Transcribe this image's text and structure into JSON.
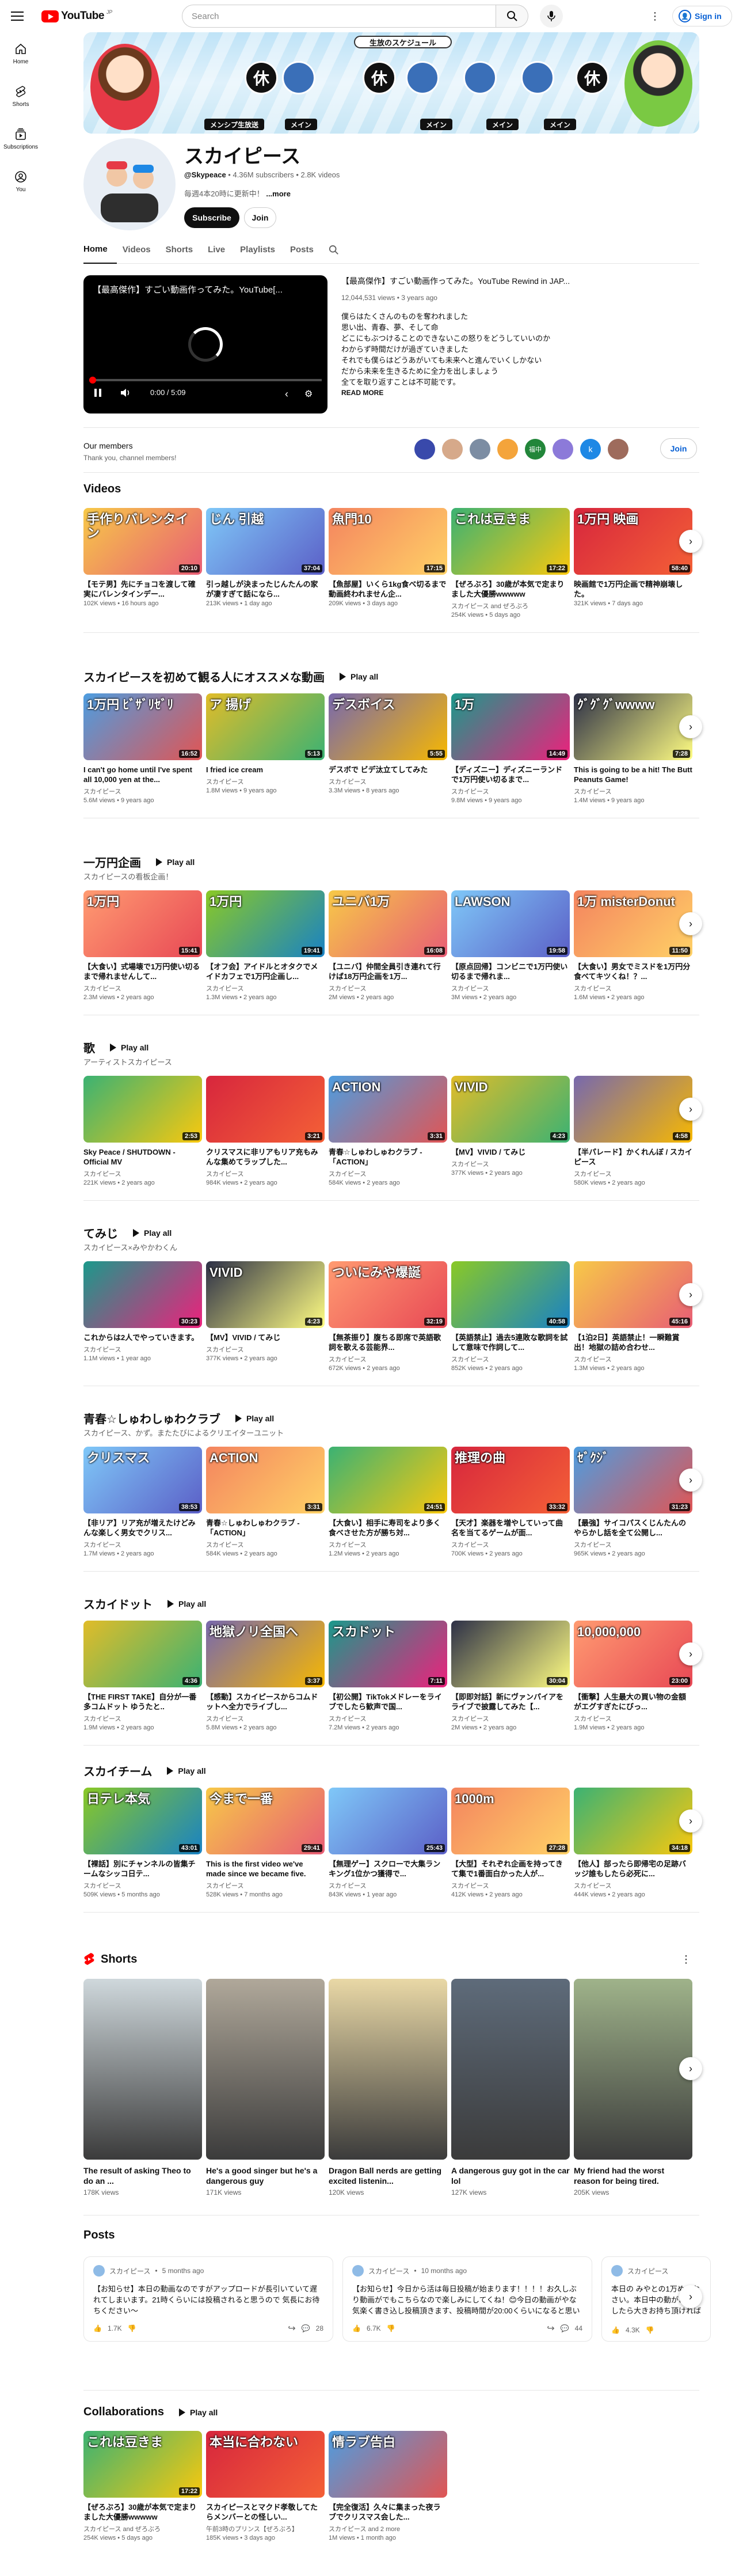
{
  "header": {
    "logo_text": "YouTube",
    "logo_cc": "JP",
    "search_placeholder": "Search",
    "signin_label": "Sign in"
  },
  "rail": [
    {
      "label": "Home",
      "icon": "home-icon"
    },
    {
      "label": "Shorts",
      "icon": "shorts-icon"
    },
    {
      "label": "Subscriptions",
      "icon": "subscriptions-icon"
    },
    {
      "label": "You",
      "icon": "you-icon"
    }
  ],
  "banner": {
    "title": "生放のスケジュール",
    "tile_text": "休",
    "tags": [
      "メンシプ生放送",
      "メイン",
      "メイン",
      "メイン",
      "メイン"
    ]
  },
  "channel": {
    "name": "スカイピース",
    "handle": "@Skypeace",
    "subscribers": "4.36M subscribers",
    "videos": "2.8K videos",
    "description": "毎週4本20時に更新中！",
    "more": "...more",
    "subscribe_label": "Subscribe",
    "join_label": "Join",
    "tabs": [
      "Home",
      "Videos",
      "Shorts",
      "Live",
      "Playlists",
      "Posts"
    ]
  },
  "featured": {
    "player_title": "【最高傑作】すごい動画作ってみた。YouTube[...",
    "time": "0:00 / 5:09",
    "title": "【最高傑作】すごい動画作ってみた。YouTube Rewind in JAP...",
    "meta": "12,044,531 views • 3 years ago",
    "description": "僕らはたくさんのものを奪われました\n思い出、青春、夢、そして命\nどこにもぶつけることのできないこの怒りをどうしていいのか\nわからず時間だけが過ぎていきました\nそれでも僕らはどうあがいても未来へと進んでいくしかない\nだから未来を生きるために全力を出しましょう\n全てを取り返すことは不可能です。",
    "read_more": "READ MORE"
  },
  "members": {
    "title": "Our members",
    "subtitle": "Thank you, channel members!",
    "avatars": [
      "",
      "",
      "",
      "",
      "福中",
      "",
      "k",
      ""
    ],
    "join_label": "Join"
  },
  "shelves": [
    {
      "title": "Videos",
      "subtitle": "",
      "play_all": "",
      "cards": [
        {
          "cap": "手作りバレンタイン",
          "dur": "20:10",
          "title": "【モテ男】先にチョコを渡して確実にバレンタインデー...",
          "channel": "",
          "meta": "102K views • 16 hours ago"
        },
        {
          "cap": "じん 引越",
          "dur": "37:04",
          "title": "引っ越しが決まったじんたんの家が凄すぎて話になら...",
          "channel": "",
          "meta": "213K views • 1 day ago"
        },
        {
          "cap": "魚門10",
          "dur": "17:15",
          "title": "【魚部屋】いくら1kg食べ切るまで動画終われません企...",
          "channel": "",
          "meta": "209K views • 3 days ago"
        },
        {
          "cap": "これは豆きま",
          "dur": "17:22",
          "title": "【ぜろぶろ】30歳が本気で定まりました大優勝wwwww",
          "channel": "スカイピース and ぜろぶろ",
          "meta": "254K views • 5 days ago"
        },
        {
          "cap": "1万円 映画",
          "dur": "58:40",
          "title": "映画館で1万円企画で精神崩壊した。",
          "channel": "",
          "meta": "321K views • 7 days ago"
        }
      ]
    },
    {
      "title": "スカイピースを初めて観る人にオススメな動画",
      "subtitle": "",
      "play_all": "Play all",
      "cards": [
        {
          "cap": "1万円 ﾋﾞｻﾞﾘｾﾞﾘ",
          "dur": "16:52",
          "title": "I can't go home until I've spent all 10,000 yen at the...",
          "channel": "スカイピース",
          "meta": "5.6M views • 9 years ago"
        },
        {
          "cap": "ア 揚げ",
          "dur": "5:13",
          "title": "I fried ice cream",
          "channel": "スカイピース",
          "meta": "1.8M views • 9 years ago"
        },
        {
          "cap": "デスボイス",
          "dur": "5:55",
          "title": "デスボで ビデ汰立てしてみた",
          "channel": "スカイピース",
          "meta": "3.3M views • 8 years ago"
        },
        {
          "cap": "1万",
          "dur": "14:49",
          "title": "【ディズニー】ディズニーランドで1万円使い切るまで...",
          "channel": "スカイピース",
          "meta": "9.8M views • 9 years ago"
        },
        {
          "cap": "ｸﾞｸﾞｸﾞwwww",
          "dur": "7:28",
          "title": "This is going to be a hit! The Butt Peanuts Game!",
          "channel": "スカイピース",
          "meta": "1.4M views • 9 years ago"
        }
      ]
    },
    {
      "title": "一万円企画",
      "subtitle": "スカイピースの看板企画！",
      "play_all": "Play all",
      "cards": [
        {
          "cap": "1万円",
          "dur": "15:41",
          "title": "【大食い】式場壊で1万円使い切るまで帰れませんして...",
          "channel": "スカイピース",
          "meta": "2.3M views • 2 years ago"
        },
        {
          "cap": "1万円",
          "dur": "19:41",
          "title": "【オフ会】アイドルとオタクでメイドカフェで1万円企画し...",
          "channel": "スカイピース",
          "meta": "1.3M views • 2 years ago"
        },
        {
          "cap": "ユニバ1万",
          "dur": "16:08",
          "title": "【ユニバ】仲間全員引き連れて行けば18万円企画を1万...",
          "channel": "スカイピース",
          "meta": "2M views • 2 years ago"
        },
        {
          "cap": "LAWSON",
          "dur": "19:58",
          "title": "【原点回帰】コンビニで1万円使い切るまで帰れま...",
          "channel": "スカイピース",
          "meta": "3M views • 2 years ago"
        },
        {
          "cap": "1万 misterDonut",
          "dur": "11:50",
          "title": "【大食い】男女でミスドを1万円分食べてキツくね！？...",
          "channel": "スカイピース",
          "meta": "1.6M views • 2 years ago"
        }
      ]
    },
    {
      "title": "歌",
      "subtitle": "アーティストスカイピース",
      "play_all": "Play all",
      "cards": [
        {
          "cap": "",
          "dur": "2:53",
          "title": "Sky Peace / SHUTDOWN - Official MV",
          "channel": "スカイピース",
          "meta": "221K views • 2 years ago"
        },
        {
          "cap": "",
          "dur": "3:21",
          "title": "クリスマスに非リアもリア充もみんな集めてラップした...",
          "channel": "スカイピース",
          "meta": "984K views • 2 years ago"
        },
        {
          "cap": "ACTION",
          "dur": "3:31",
          "title": "青春☆しゅわしゅわクラブ - 「ACTION」",
          "channel": "スカイピース",
          "meta": "584K views • 2 years ago"
        },
        {
          "cap": "VIVID",
          "dur": "4:23",
          "title": "【MV】VIVID / てみじ",
          "channel": "スカイピース",
          "meta": "377K views • 2 years ago"
        },
        {
          "cap": "",
          "dur": "4:58",
          "title": "【半パレード】かくれんぼ / スカイピース",
          "channel": "スカイピース",
          "meta": "580K views • 2 years ago"
        }
      ]
    },
    {
      "title": "てみじ",
      "subtitle": "スカイピース×みやかわくん",
      "play_all": "Play all",
      "cards": [
        {
          "cap": "",
          "dur": "30:23",
          "title": "これからは2人でやっていきます。",
          "channel": "スカイピース",
          "meta": "1.1M views • 1 year ago"
        },
        {
          "cap": "VIVID",
          "dur": "4:23",
          "title": "【MV】VIVID / てみじ",
          "channel": "スカイピース",
          "meta": "377K views • 2 years ago"
        },
        {
          "cap": "ついにみや爆誕",
          "dur": "32:19",
          "title": "【無茶振り】腹ちる即席で英語歌詞を歌える芸能界...",
          "channel": "スカイピース",
          "meta": "672K views • 2 years ago"
        },
        {
          "cap": "",
          "dur": "40:58",
          "title": "【英語禁止】過去5連敗な歌詞を試して意味で作詞して...",
          "channel": "スカイピース",
          "meta": "852K views • 2 years ago"
        },
        {
          "cap": "",
          "dur": "45:16",
          "title": "【1泊2日】英語禁止！一瞬難賞出！地獄の詰め合わせ...",
          "channel": "スカイピース",
          "meta": "1.3M views • 2 years ago"
        }
      ]
    },
    {
      "title": "青春☆しゅわしゅわクラブ",
      "subtitle": "スカイピース、かず。またたびによるクリエイターユニット",
      "play_all": "Play all",
      "cards": [
        {
          "cap": "クリスマス",
          "dur": "38:53",
          "title": "【非リア】リア充が増えたけどみんな楽しく男女でクリス...",
          "channel": "スカイピース",
          "meta": "1.7M views • 2 years ago"
        },
        {
          "cap": "ACTION",
          "dur": "3:31",
          "title": "青春☆しゅわしゅわクラブ - 「ACTION」",
          "channel": "スカイピース",
          "meta": "584K views • 2 years ago"
        },
        {
          "cap": "",
          "dur": "24:51",
          "title": "【大食い】相手に寿司をより多く食べさせた方が勝ち対...",
          "channel": "スカイピース",
          "meta": "1.2M views • 2 years ago"
        },
        {
          "cap": "推理の曲",
          "dur": "33:32",
          "title": "【天才】楽器を増やしていって曲名を当てるゲームが面...",
          "channel": "スカイピース",
          "meta": "700K views • 2 years ago"
        },
        {
          "cap": "ｾﾞｸｼﾞ",
          "dur": "31:23",
          "title": "【最強】サイコパスくじんたんのやらかし話を全て公開し...",
          "channel": "スカイピース",
          "meta": "965K views • 2 years ago"
        }
      ]
    },
    {
      "title": "スカイドット",
      "subtitle": "",
      "play_all": "Play all",
      "cards": [
        {
          "cap": "",
          "dur": "4:36",
          "title": "【THE FIRST TAKE】自分が一番多コムドット ゆうたと..",
          "channel": "スカイピース",
          "meta": "1.9M views • 2 years ago"
        },
        {
          "cap": "地獄ノリ全国へ",
          "dur": "3:37",
          "title": "【感動】スカイピースからコムドットへ全力でライブし...",
          "channel": "スカイピース",
          "meta": "5.8M views • 2 years ago"
        },
        {
          "cap": "スカドット",
          "dur": "7:11",
          "title": "【初公開】TikTokメドレーをライブでしたら歓声で国...",
          "channel": "スカイピース",
          "meta": "7.2M views • 2 years ago"
        },
        {
          "cap": "",
          "dur": "30:04",
          "title": "【即即対話】新にヴァンパイアをライブで披露してみた【...",
          "channel": "スカイピース",
          "meta": "2M views • 2 years ago"
        },
        {
          "cap": "10,000,000",
          "dur": "23:00",
          "title": "【衝撃】人生最大の買い物の金額がエグすぎたにびっ...",
          "channel": "スカイピース",
          "meta": "1.9M views • 2 years ago"
        }
      ]
    },
    {
      "title": "スカイチーム",
      "subtitle": "",
      "play_all": "Play all",
      "cards": [
        {
          "cap": "日テレ本気",
          "dur": "43:01",
          "title": "【裸話】別にチャンネルの皆集チームなシッコ日テ...",
          "channel": "スカイピース",
          "meta": "509K views • 5 months ago"
        },
        {
          "cap": "今まで一番",
          "dur": "29:41",
          "title": "This is the first video we've made since we became five.",
          "channel": "スカイピース",
          "meta": "528K views • 7 months ago"
        },
        {
          "cap": "",
          "dur": "25:43",
          "title": "【無理ゲー】スクローで大集ランキング1位かつ獲得で...",
          "channel": "スカイピース",
          "meta": "843K views • 1 year ago"
        },
        {
          "cap": "1000m",
          "dur": "27:28",
          "title": "【大型】それぞれ企画を持ってきて集で1番面白かった人が...",
          "channel": "スカイピース",
          "meta": "412K views • 2 years ago"
        },
        {
          "cap": "",
          "dur": "34:18",
          "title": "【他人】部ったら即帰宅の足跡バッジ誰もしたら必死に...",
          "channel": "スカイピース",
          "meta": "444K views • 2 years ago"
        }
      ]
    }
  ],
  "shorts": {
    "title": "Shorts",
    "items": [
      {
        "title": "The result of asking Theo to do an ...",
        "views": "178K views"
      },
      {
        "title": "He's a good singer but he's a dangerous guy",
        "views": "171K views"
      },
      {
        "title": "Dragon Ball nerds are getting excited listenin...",
        "views": "120K views"
      },
      {
        "title": "A dangerous guy got in the car lol",
        "views": "127K views"
      },
      {
        "title": "My friend had the worst reason for being tired.",
        "views": "205K views"
      }
    ]
  },
  "posts": {
    "title": "Posts",
    "items": [
      {
        "author": "スカイピース",
        "time": "5 months ago",
        "body": "【お知らせ】本日の動画なのですがアップロードが長引いていて遅れてしまいます。21時くらいには投稿されると思うので 気長にお待ちください〜",
        "likes": "1.7K",
        "comments": "28"
      },
      {
        "author": "スカイピース",
        "time": "10 months ago",
        "body": "【お知らせ】今日から活は毎日投稿が始まります！！！！お久しぶり動画がでもこちらなので楽しみにしてくね！😊今日の動画がやな気楽く書き込し投稿頂きます、投稿時間が20:00くらいになると思います！お楽しみにです！！！！！",
        "likes": "6.7K",
        "comments": "44"
      },
      {
        "author": "スカイピース",
        "time": "",
        "body": "本日の みやとの1万めんなさい。本日中の動がありましたら大きお持ち頂ければと...",
        "likes": "4.3K",
        "comments": ""
      }
    ]
  },
  "collaborations": {
    "title": "Collaborations",
    "play_all": "Play all",
    "cards": [
      {
        "cap": "これは豆きま",
        "dur": "17:22",
        "title": "【ぜろぶろ】30歳が本気で定まりました大優勝wwwww",
        "channel": "スカイピース and ぜろぶろ",
        "meta": "254K views • 5 days ago"
      },
      {
        "cap": "本当に合わない",
        "dur": "",
        "title": "スカイピースとマクド孝敬してたらメンバーとの怪しい...",
        "channel": "午前3時のプリンス【ぜろぶろ】",
        "meta": "185K views • 3 days ago"
      },
      {
        "cap": "情ラブ告白",
        "dur": "",
        "title": "【完全復活】久々に集まった夜ラブでクリスマス会した...",
        "channel": "スカイピース and 2 more",
        "meta": "1M views • 1 month ago"
      }
    ]
  },
  "colors": {
    "accent": "#ff0000",
    "link": "#065fd4",
    "text": "#0f0f0f",
    "muted": "#606060"
  }
}
